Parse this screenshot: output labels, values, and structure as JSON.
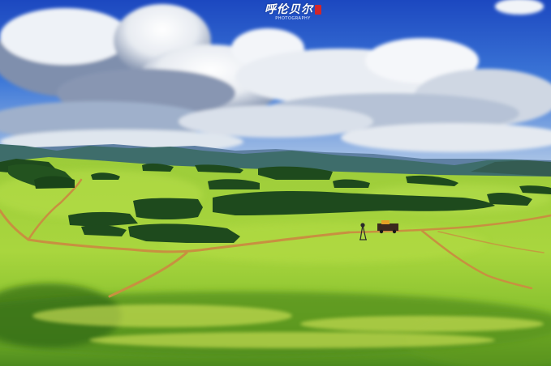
{
  "scene": {
    "colors": {
      "sky_top": "#1f52c8",
      "sky_mid": "#3b74d8",
      "cloud_light": "#f4f6f9",
      "cloud_shadow": "#8a98b3",
      "mountain_far": "#5c7fa0",
      "mountain_near": "#3f6e6a",
      "grass_bright": "#a6d43a",
      "grass_mid": "#7fb92a",
      "grass_dark": "#4f8a1c",
      "trees": "#1d4a1c",
      "dirt_road": "#c8903f"
    },
    "icons": [
      "windmill-icon",
      "vehicle-icon"
    ]
  },
  "watermark": {
    "title": "呼伦贝尔",
    "subtitle": "PHOTOGRAPHY",
    "seal_color": "#d0262c"
  }
}
